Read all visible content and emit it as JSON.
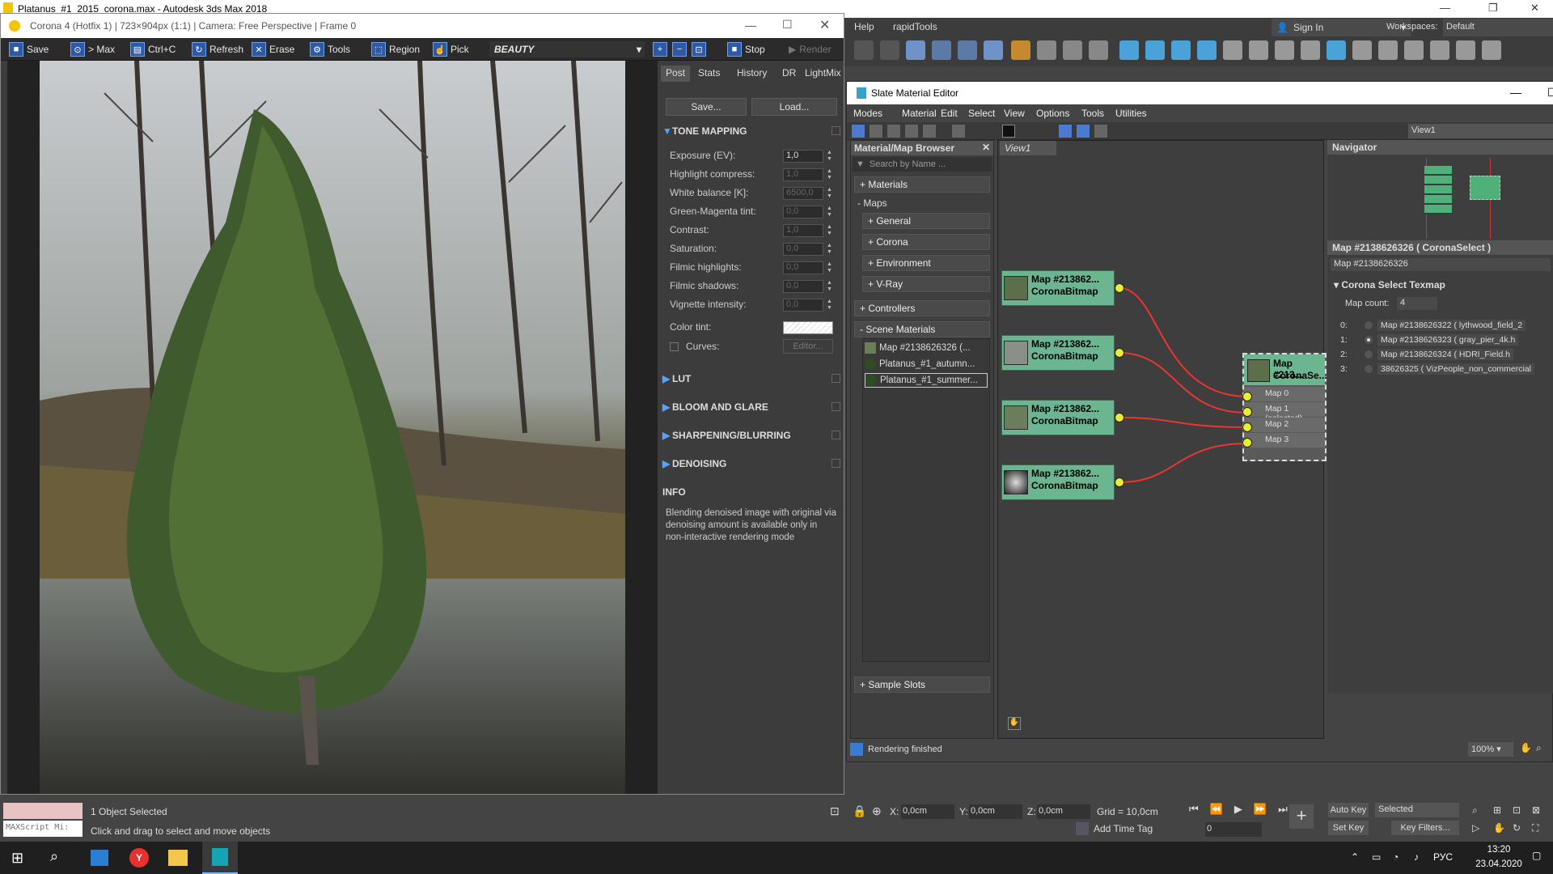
{
  "max": {
    "title": "Platanus_#1_2015_corona.max - Autodesk 3ds Max 2018",
    "menu": {
      "help": "Help",
      "rapid": "rapidTools",
      "sign_in": "Sign In",
      "workspaces_label": "Workspaces:",
      "workspace": "Default"
    }
  },
  "corona": {
    "title": "Corona 4 (Hotfix 1) | 723×904px (1:1) | Camera: Free Perspective | Frame 0",
    "toolbar": {
      "save": "Save",
      "tomax": "> Max",
      "copy": "Ctrl+C",
      "refresh": "Refresh",
      "erase": "Erase",
      "tools": "Tools",
      "region": "Region",
      "pick": "Pick",
      "pass": "BEAUTY",
      "stop": "Stop",
      "render": "Render"
    },
    "tabs": [
      "Post",
      "Stats",
      "History",
      "DR",
      "LightMix"
    ],
    "save_btn": "Save...",
    "load_btn": "Load...",
    "sections": {
      "tone": "TONE MAPPING",
      "lut": "LUT",
      "bloom": "BLOOM AND GLARE",
      "sharp": "SHARPENING/BLURRING",
      "denoise": "DENOISING",
      "info": "INFO"
    },
    "params": [
      {
        "label": "Exposure (EV):",
        "value": "1,0"
      },
      {
        "label": "Highlight compress:",
        "value": "1,0"
      },
      {
        "label": "White balance [K]:",
        "value": "6500,0"
      },
      {
        "label": "Green-Magenta tint:",
        "value": "0,0"
      },
      {
        "label": "Contrast:",
        "value": "1,0"
      },
      {
        "label": "Saturation:",
        "value": "0,0"
      },
      {
        "label": "Filmic highlights:",
        "value": "0,0"
      },
      {
        "label": "Filmic shadows:",
        "value": "0,0"
      },
      {
        "label": "Vignette intensity:",
        "value": "0,0"
      }
    ],
    "color_tint": "Color tint:",
    "curves": "Curves:",
    "editor": "Editor...",
    "info_text": "Blending denoised image with original via denoising amount is available only in non-interactive rendering mode"
  },
  "slate": {
    "title": "Slate Material Editor",
    "menu": [
      "Modes",
      "Material",
      "Edit",
      "Select",
      "View",
      "Options",
      "Tools",
      "Utilities"
    ],
    "view_label": "View1",
    "browser": {
      "title": "Material/Map Browser",
      "search": "Search by Name ...",
      "materials": "+ Materials",
      "maps": "- Maps",
      "general": "+ General",
      "corona": "+ Corona",
      "environment": "+ Environment",
      "vray": "+ V-Ray",
      "controllers": "+ Controllers",
      "scene": "- Scene Materials",
      "scene_items": [
        "Map #2138626326  (...",
        "Platanus_#1_autumn...",
        "Platanus_#1_summer..."
      ],
      "sample": "+ Sample Slots"
    },
    "view_tab": "View1",
    "nodes": [
      {
        "l1": "Map #213862...",
        "l2": "CoronaBitmap"
      },
      {
        "l1": "Map #213862...",
        "l2": "CoronaBitmap"
      },
      {
        "l1": "Map #213862...",
        "l2": "CoronaBitmap"
      },
      {
        "l1": "Map #213862...",
        "l2": "CoronaBitmap"
      }
    ],
    "select_node": {
      "l1": "Map #213...",
      "l2": "CoronaSe...",
      "slots": [
        "Map 0",
        "Map 1 (selected)",
        "Map 2",
        "Map 3"
      ]
    },
    "navigator": "Navigator",
    "props": {
      "header": "Map #2138626326  ( CoronaSelect )",
      "name": "Map #2138626326",
      "rollout": "Corona Select Texmap",
      "count_label": "Map count:",
      "count": "4",
      "maps": [
        {
          "idx": "0:",
          "text": "Map #2138626322 ( lythwood_field_2"
        },
        {
          "idx": "1:",
          "text": "Map #2138626323 ( gray_pier_4k.h"
        },
        {
          "idx": "2:",
          "text": "Map #2138626324 ( HDRI_Field.h"
        },
        {
          "idx": "3:",
          "text": "38626325 ( VizPeople_non_commercial"
        }
      ]
    },
    "status": "Rendering finished",
    "zoom": "100%"
  },
  "status": {
    "maxscript": "MAXScript Mi:",
    "selected": "1 Object Selected",
    "hint": "Click and drag to select and move objects",
    "x_label": "X:",
    "x": "0,0cm",
    "y_label": "Y:",
    "y": "0,0cm",
    "z_label": "Z:",
    "z": "0,0cm",
    "grid": "Grid = 10,0cm",
    "add_time_tag": "Add Time Tag",
    "auto_key": "Auto Key",
    "set_key": "Set Key",
    "selected_dd": "Selected",
    "key_filters": "Key Filters...",
    "frame": "0"
  },
  "taskbar": {
    "lang": "РУС",
    "time": "13:20",
    "date": "23.04.2020"
  }
}
